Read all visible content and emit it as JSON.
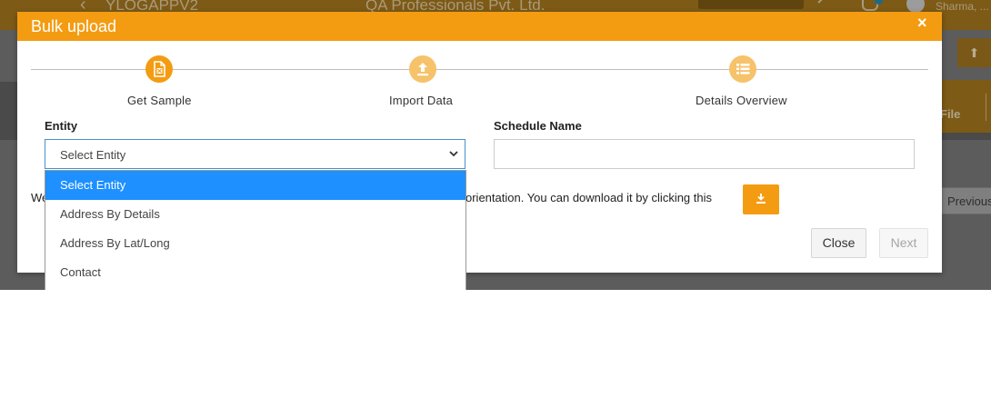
{
  "background": {
    "app_name": "YLOGAPPV2",
    "company": "QA Professionals Pvt. Ltd.",
    "user": "Sharma, ...",
    "table_column": "File",
    "pagination_prev": "Previous",
    "back_icon": "chevron-left-icon"
  },
  "modal": {
    "title": "Bulk upload",
    "close_glyph": "×",
    "steps": [
      {
        "label": "Get Sample",
        "icon": "excel-file-icon",
        "state": "active"
      },
      {
        "label": "Import Data",
        "icon": "upload-icon",
        "state": "inactive"
      },
      {
        "label": "Details Overview",
        "icon": "list-icon",
        "state": "inactive"
      }
    ],
    "entity_label": "Entity",
    "entity_selected": "Select Entity",
    "schedule_label": "Schedule Name",
    "schedule_value": "",
    "info_text_visible_start": "We",
    "info_text_visible_end": "orientation. You can download it by clicking this",
    "download_icon": "download-icon",
    "close_button": "Close",
    "next_button": "Next"
  },
  "dropdown": {
    "options": [
      "Select Entity",
      "Address By Details",
      "Address By Lat/Long",
      "Contact"
    ],
    "selected_index": 0
  },
  "colors": {
    "accent": "#f39c12",
    "selected_option": "#1e90ff"
  }
}
